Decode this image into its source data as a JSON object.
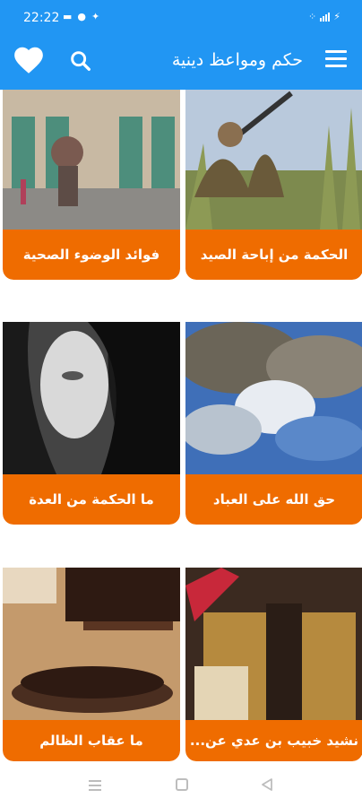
{
  "status_bar": {
    "time": "22:22",
    "left_icons": [
      "notification-icon",
      "shield-icon",
      "usb-icon"
    ],
    "right_icons": [
      "wifi-icon",
      "signal-icon",
      "battery-charging-icon"
    ]
  },
  "app_bar": {
    "title": "حكم ومواعظ دينية",
    "icons": [
      "heart-icon",
      "search-icon",
      "menu-icon"
    ],
    "color": "#2196f3"
  },
  "cards": [
    {
      "label": "الحكمة من إباحة الصيد",
      "image": "hunter-photo"
    },
    {
      "label": "فوائد الوضوء الصحية",
      "image": "mosque-courtyard-photo"
    },
    {
      "label": "حق الله على العباد",
      "image": "cloudy-sky-photo"
    },
    {
      "label": "ما الحكمة من العدة",
      "image": "woman-portrait-photo"
    },
    {
      "label": "نشيد خبيب بن عدي عن...",
      "image": "old-book-photo"
    },
    {
      "label": "ما عقاب الظالم",
      "image": "gavel-photo"
    }
  ],
  "colors": {
    "accent": "#ef6c00",
    "primary": "#2196f3"
  },
  "nav_bar": {
    "icons": [
      "recent-apps-icon",
      "home-icon",
      "back-icon"
    ]
  }
}
